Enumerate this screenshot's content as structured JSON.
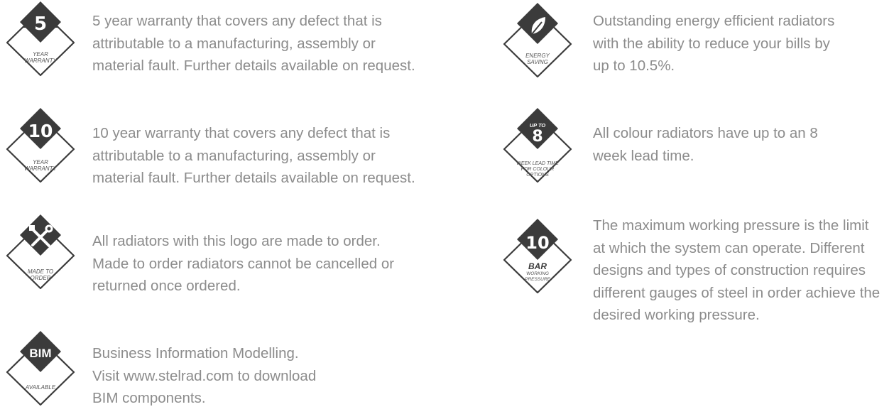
{
  "features": [
    {
      "id": "five-year",
      "badge": {
        "big": "5",
        "caption": [
          "YEAR",
          "WARRANTY"
        ],
        "icon": "number-badge"
      },
      "lines": [
        "5 year warranty that covers any defect that is",
        "attributable to a manufacturing, assembly or",
        "material fault. Further details available on request."
      ]
    },
    {
      "id": "ten-year",
      "badge": {
        "big": "10",
        "caption": [
          "YEAR",
          "WARRANTY"
        ],
        "icon": "number-badge"
      },
      "lines": [
        "10 year warranty that covers any defect that is",
        "attributable to a manufacturing, assembly or",
        "material fault. Further details available on request."
      ]
    },
    {
      "id": "made-to-order",
      "badge": {
        "caption": [
          "MADE TO",
          "ORDER"
        ],
        "icon": "tools-icon"
      },
      "lines": [
        "All radiators with this logo are made to order.",
        "Made to order radiators cannot be cancelled or",
        "returned once ordered."
      ]
    },
    {
      "id": "bim",
      "badge": {
        "big": "BIM",
        "caption": [
          "AVAILABLE"
        ],
        "icon": "bim-badge"
      },
      "lines": [
        "Business Information Modelling.",
        "Visit www.stelrad.com to download",
        "BIM components."
      ]
    },
    {
      "id": "energy",
      "badge": {
        "caption": [
          "ENERGY",
          "SAVING"
        ],
        "icon": "leaf-icon"
      },
      "lines": [
        "Outstanding energy efficient radiators",
        "with the ability to reduce your bills by",
        "up to 10.5%."
      ]
    },
    {
      "id": "lead-time",
      "badge": {
        "top": "UP TO",
        "big": "8",
        "caption": [
          "WEEK LEAD TIME",
          "FOR COLOUR",
          "OPTIONS"
        ],
        "icon": "lead-time-badge"
      },
      "lines": [
        "All colour radiators have up to an 8",
        "week lead time."
      ]
    },
    {
      "id": "pressure",
      "badge": {
        "big": "10",
        "sub": "BAR",
        "caption": [
          "WORKING",
          "PRESSURE"
        ],
        "icon": "pressure-badge"
      },
      "lines": [
        "The maximum working pressure is the limit",
        "at which the system can operate. Different",
        "designs and types of construction requires",
        "different gauges of steel in order achieve the",
        "desired working pressure."
      ]
    }
  ],
  "colors": {
    "badge_dark": "#3b3b3b",
    "outline": "#3b3b3b",
    "text": "#8c8c8c"
  }
}
